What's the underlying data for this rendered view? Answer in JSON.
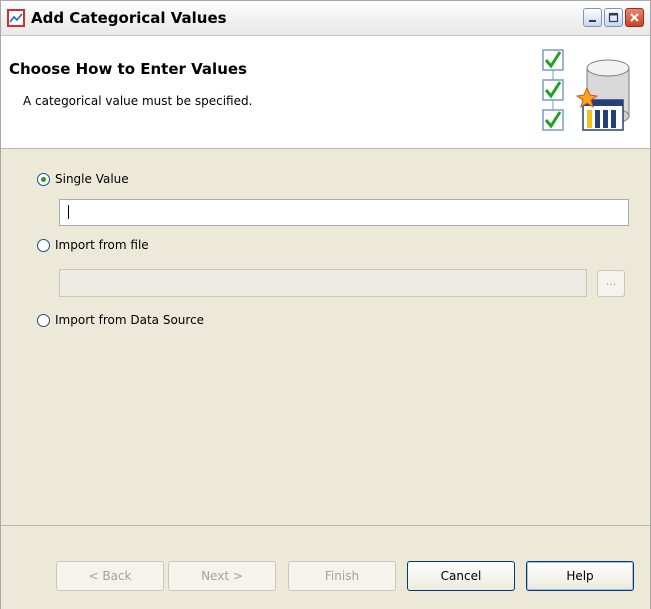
{
  "window": {
    "title": "Add Categorical Values",
    "icon": "chart-icon",
    "controls": [
      "minimize-icon",
      "maximize-icon",
      "close-icon"
    ]
  },
  "header": {
    "title": "Choose How to Enter Values",
    "subtitle": "A categorical value must be specified."
  },
  "options": {
    "single_value": {
      "label": "Single Value",
      "checked": true,
      "value": ""
    },
    "import_file": {
      "label": "Import from file",
      "checked": false,
      "value": "",
      "browse_label": "..."
    },
    "import_datasource": {
      "label": "Import from Data Source",
      "checked": false
    }
  },
  "footer": {
    "back": "< Back",
    "next": "Next >",
    "finish": "Finish",
    "cancel": "Cancel",
    "help": "Help"
  },
  "colors": {
    "dialog_bg": "#ece9d8",
    "header_bg": "#ffffff",
    "check_green": "#21a121",
    "close_red": "#c7432c"
  }
}
